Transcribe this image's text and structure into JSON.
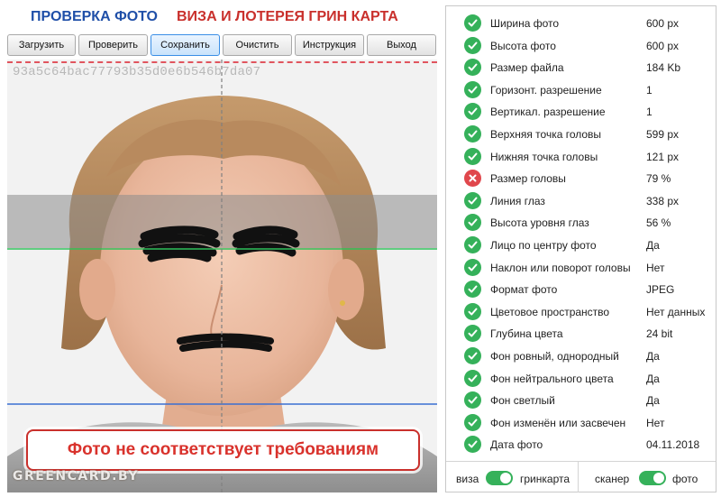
{
  "header": {
    "title_primary": "ПРОВЕРКА ФОТО",
    "title_secondary": "ВИЗА И ЛОТЕРЕЯ ГРИН КАРТА"
  },
  "toolbar": {
    "buttons": [
      {
        "label": "Загрузить"
      },
      {
        "label": "Проверить"
      },
      {
        "label": "Сохранить"
      },
      {
        "label": "Очистить"
      },
      {
        "label": "Инструкция"
      },
      {
        "label": "Выход"
      }
    ],
    "active_button": "Сохранить"
  },
  "photo": {
    "file_id": "93a5c64bac77793b35d0e6b546b7da07",
    "watermark": "GREENCARD.BY",
    "verdict": "Фото не соответствует требованиям",
    "guide_colors": {
      "eye_line": "#2fbf5a",
      "bottom_line": "#3b6fd1",
      "center_line": "#808080",
      "top_dashed": "#e0555e"
    }
  },
  "checks": [
    {
      "status": "ok",
      "label": "Ширина фото",
      "value": "600 px"
    },
    {
      "status": "ok",
      "label": "Высота фото",
      "value": "600 px"
    },
    {
      "status": "ok",
      "label": "Размер файла",
      "value": "184 Kb"
    },
    {
      "status": "ok",
      "label": "Горизонт. разрешение",
      "value": "1"
    },
    {
      "status": "ok",
      "label": "Вертикал. разрешение",
      "value": "1"
    },
    {
      "status": "ok",
      "label": "Верхняя точка головы",
      "value": "599 px"
    },
    {
      "status": "ok",
      "label": "Нижняя точка головы",
      "value": "121 px"
    },
    {
      "status": "fail",
      "label": "Размер головы",
      "value": "79 %"
    },
    {
      "status": "ok",
      "label": "Линия глаз",
      "value": "338 px"
    },
    {
      "status": "ok",
      "label": "Высота уровня глаз",
      "value": "56 %"
    },
    {
      "status": "ok",
      "label": "Лицо по центру фото",
      "value": "Да"
    },
    {
      "status": "ok",
      "label": "Наклон или поворот головы",
      "value": "Нет"
    },
    {
      "status": "ok",
      "label": "Формат фото",
      "value": "JPEG"
    },
    {
      "status": "ok",
      "label": "Цветовое пространство",
      "value": "Нет данных"
    },
    {
      "status": "ok",
      "label": "Глубина цвета",
      "value": "24 bit"
    },
    {
      "status": "ok",
      "label": "Фон ровный, однородный",
      "value": "Да"
    },
    {
      "status": "ok",
      "label": "Фон нейтрального цвета",
      "value": "Да"
    },
    {
      "status": "ok",
      "label": "Фон светлый",
      "value": "Да"
    },
    {
      "status": "ok",
      "label": "Фон изменён или засвечен",
      "value": "Нет"
    },
    {
      "status": "ok",
      "label": "Дата фото",
      "value": "04.11.2018"
    }
  ],
  "footer": {
    "toggle1": {
      "left_label": "виза",
      "right_label": "гринкарта",
      "state": "on"
    },
    "toggle2": {
      "left_label": "сканер",
      "right_label": "фото",
      "state": "on"
    }
  },
  "colors": {
    "ok": "#35b15a",
    "fail": "#e0474c",
    "title_blue": "#1f4fa8",
    "title_red": "#c9302c"
  }
}
